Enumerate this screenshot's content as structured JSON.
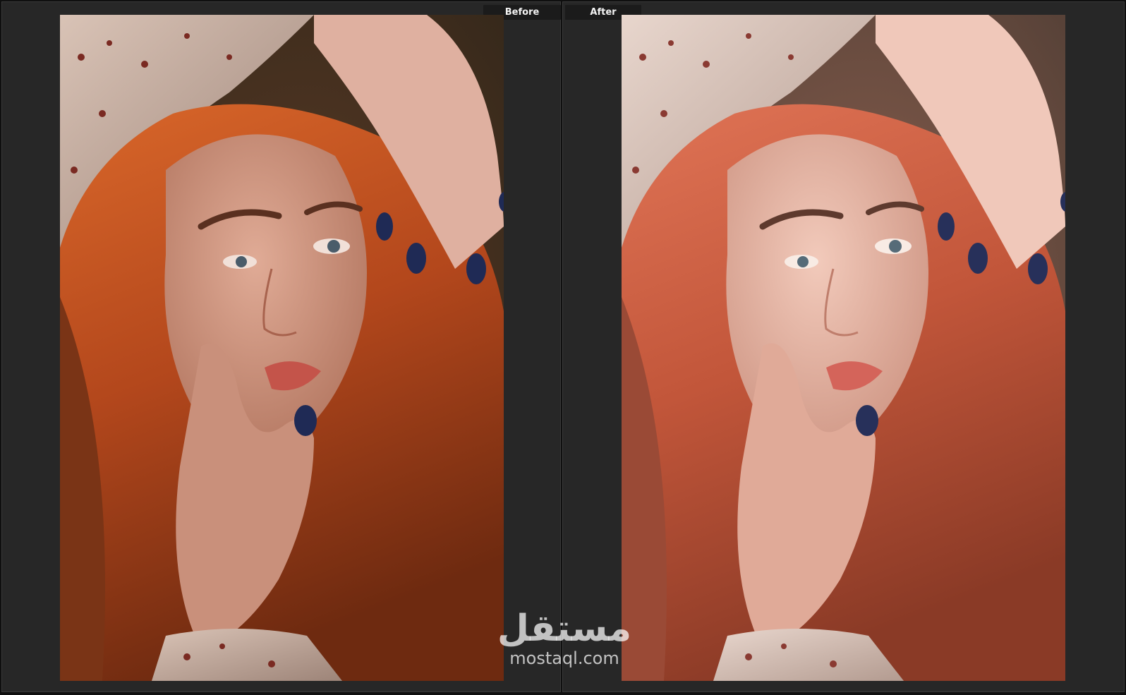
{
  "panels": {
    "before": {
      "label": "Before"
    },
    "after": {
      "label": "After"
    }
  },
  "watermark": {
    "arabic": "مستقل",
    "latin": "mostaql.com"
  },
  "colors": {
    "background": "#0f0f0f",
    "panel": "#272727",
    "label_bg": "#1b1b1b",
    "hair_before": "#b3471c",
    "hair_after": "#c2563a",
    "skin_before": "#d49b85",
    "skin_after": "#e6b6a6",
    "nail_polish": "#1f2a55"
  }
}
